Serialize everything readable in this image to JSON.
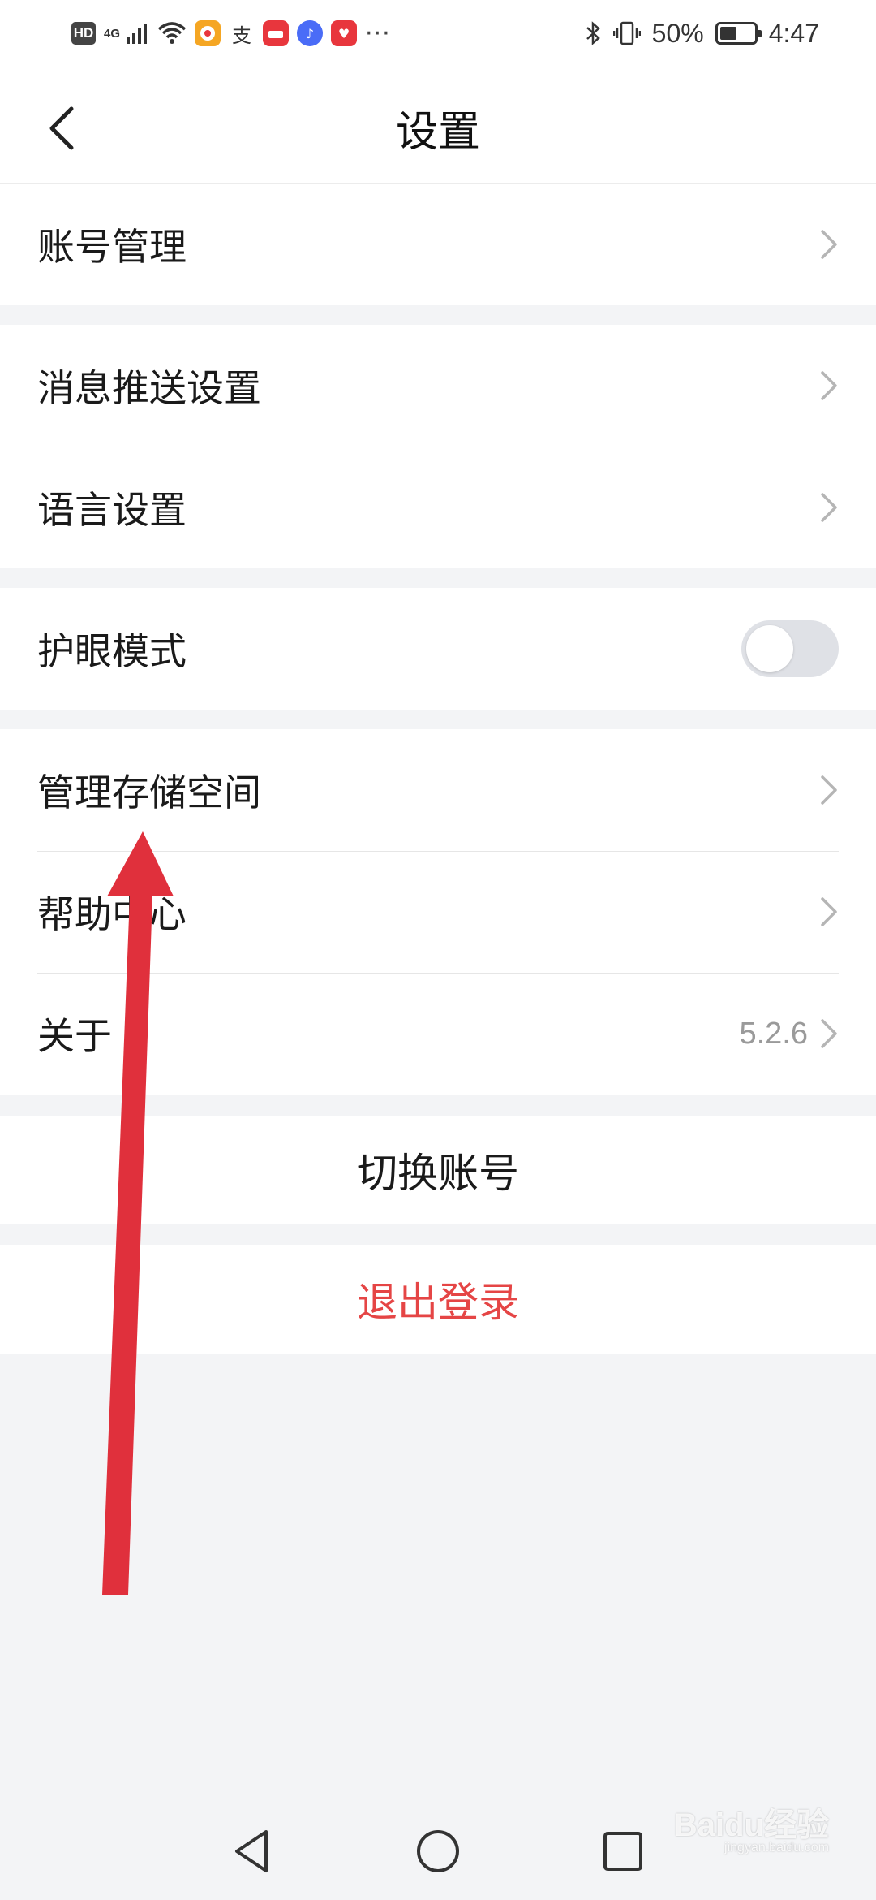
{
  "status_bar": {
    "hd": "HD",
    "network": "4G",
    "battery_percent": "50%",
    "battery_level": 0.5,
    "time": "4:47",
    "more": "···",
    "app_icons": [
      {
        "name": "emoji-app-icon",
        "color": "#f5a623",
        "glyph": "●"
      },
      {
        "name": "alipay-icon",
        "color": "#ffffff",
        "glyph": "支"
      },
      {
        "name": "huawei-store-icon",
        "color": "#e8363d",
        "glyph": "▪"
      },
      {
        "name": "music-icon",
        "color": "#4a6cf7",
        "glyph": "♪"
      },
      {
        "name": "heart-app-icon",
        "color": "#e8363d",
        "glyph": "♥"
      }
    ]
  },
  "header": {
    "title": "设置"
  },
  "groups": [
    {
      "items": [
        {
          "label": "账号管理",
          "type": "link"
        }
      ]
    },
    {
      "items": [
        {
          "label": "消息推送设置",
          "type": "link"
        },
        {
          "label": "语言设置",
          "type": "link"
        }
      ]
    },
    {
      "items": [
        {
          "label": "护眼模式",
          "type": "toggle",
          "value": false
        }
      ]
    },
    {
      "items": [
        {
          "label": "管理存储空间",
          "type": "link"
        },
        {
          "label": "帮助中心",
          "type": "link"
        },
        {
          "label": "关于",
          "type": "link",
          "value": "5.2.6"
        }
      ]
    }
  ],
  "actions": {
    "switch_account": "切换账号",
    "logout": "退出登录"
  },
  "colors": {
    "logout_text": "#e54545",
    "overlay_arrow": "#e0303c",
    "background": "#f3f4f6"
  },
  "watermark": {
    "text": "Baidu经验",
    "sub": "jingyan.baidu.com"
  }
}
